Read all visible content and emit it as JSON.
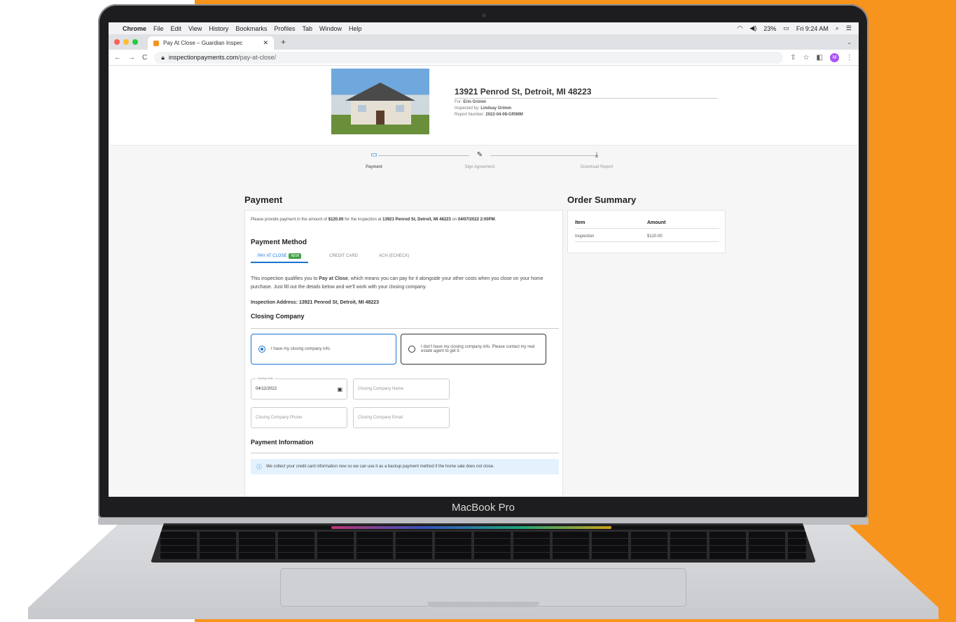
{
  "device": {
    "label": "MacBook Pro"
  },
  "menubar": {
    "items": [
      "Chrome",
      "File",
      "Edit",
      "View",
      "History",
      "Bookmarks",
      "Profiles",
      "Tab",
      "Window",
      "Help"
    ],
    "battery": "23%",
    "clock": "Fri 9:24 AM"
  },
  "browser": {
    "tab_title": "Pay At Close – Guardian Inspec",
    "url_host": "inspectionpayments.com",
    "url_path": "/pay-at-close/",
    "avatar_letter": "M"
  },
  "header": {
    "address": "13921 Penrod St, Detroit, MI 48223",
    "for_label": "For:",
    "for_name": "Erin Grimm",
    "inspected_label": "Inspected by:",
    "inspector": "Lindsay Grimm",
    "report_label": "Report Number:",
    "report_number": "2022-04-08-GRIMM"
  },
  "steps": [
    {
      "label": "Payment"
    },
    {
      "label": "Sign Agreement"
    },
    {
      "label": "Download Report"
    }
  ],
  "payment": {
    "title": "Payment",
    "intro_a": "Please provide payment in the amount of ",
    "amount": "$120.00",
    "intro_b": " for the inspection at ",
    "intro_addr": "13921 Penrod St, Detroit, MI 48223",
    "intro_c": " on ",
    "intro_date": "04/07/2022 2:00PM",
    "intro_d": ".",
    "method_title": "Payment Method",
    "tabs": [
      "PAY AT CLOSE",
      "CREDIT CARD",
      "ACH (ECHECK)"
    ],
    "new_badge": "NEW",
    "qual_a": "This inspection qualifies you to ",
    "qual_b": "Pay at Close",
    "qual_c": ", which means you can pay for it alongside your other costs when you close on your home purchase. Just fill out the details below and we'll work with your closing company.",
    "insp_addr": "Inspection Address: 13921 Penrod St, Detroit, MI 48223",
    "closing_title": "Closing Company",
    "radio_have": "I have my closing company info.",
    "radio_dont": "I don't have my closing company info. Please contact my real estate agent to get it.",
    "closing_date_label": "Closing Date",
    "closing_date": "04/12/2022",
    "name_placeholder": "Closing Company Name",
    "phone_placeholder": "Closing Company Phone",
    "email_placeholder": "Closing Company Email",
    "info_title": "Payment Information",
    "info_note": "We collect your credit card information now so we can use it as a backup payment method if the home sale does not close."
  },
  "summary": {
    "title": "Order Summary",
    "col_item": "Item",
    "col_amount": "Amount",
    "rows": [
      {
        "item": "Inspection",
        "amount": "$120.00"
      }
    ]
  },
  "colors": {
    "accent": "#1976d2",
    "background": "#f7941d",
    "badge": "#43a047"
  }
}
